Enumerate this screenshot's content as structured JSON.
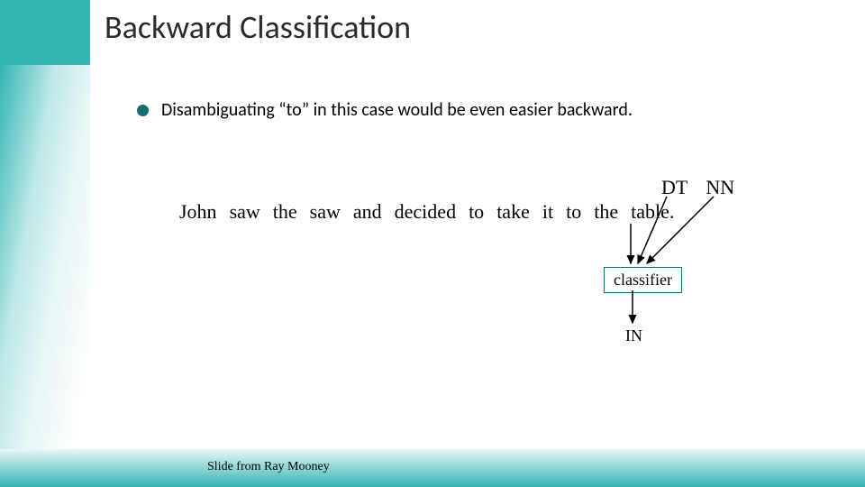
{
  "heading": "Backward Classification",
  "bullet": "Disambiguating “to” in this case would be even easier backward.",
  "tags": {
    "dt": "DT",
    "nn": "NN"
  },
  "words": {
    "w0": "John",
    "w1": "saw",
    "w2": "the",
    "w3": "saw",
    "w4": "and",
    "w5": "decided",
    "w6": "to",
    "w7": "take",
    "w8": "it",
    "w9": "to",
    "w10": "the",
    "w11": "table."
  },
  "classifier": "classifier",
  "output": "IN",
  "attribution": "Slide from Ray Mooney"
}
